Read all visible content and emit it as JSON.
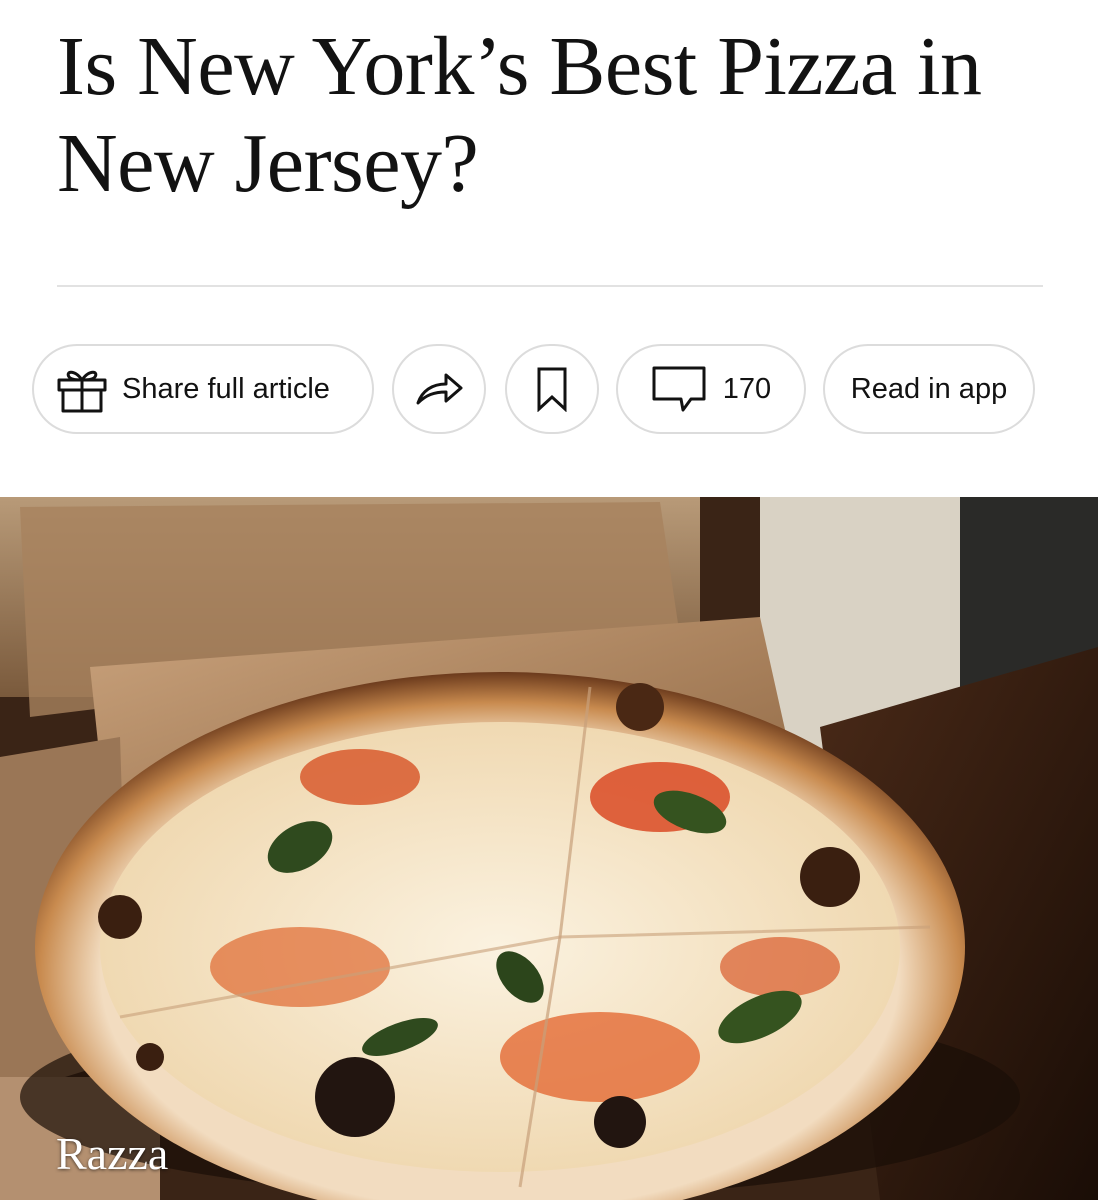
{
  "article": {
    "headline": "Is New York’s Best Pizza in New Jersey?"
  },
  "toolbar": {
    "share_full_label": "Share full article",
    "comment_count": "170",
    "read_in_app_label": "Read in app"
  },
  "hero": {
    "caption": "Razza"
  },
  "icons": {
    "share_full": "gift-icon",
    "share": "share-arrow-icon",
    "save": "bookmark-icon",
    "comments": "comment-bubble-icon"
  },
  "colors": {
    "text": "#121212",
    "pill_border": "#dcdcdc",
    "divider": "#e2e2e2"
  }
}
